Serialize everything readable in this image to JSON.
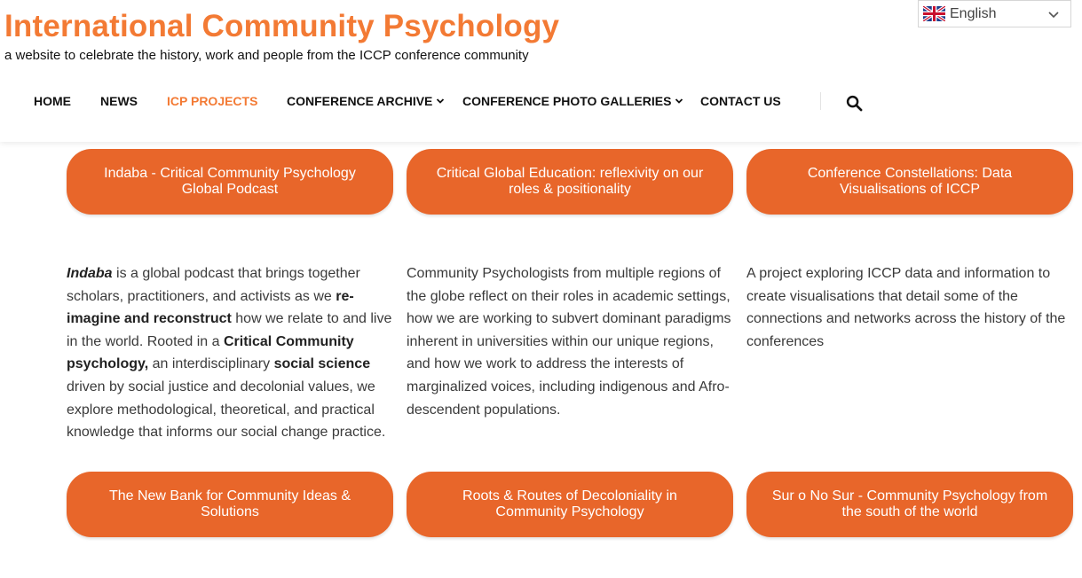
{
  "site": {
    "title": "International Community Psychology",
    "tagline": "a website to celebrate the history, work and people from the ICCP conference community"
  },
  "language": {
    "selected": "English",
    "flag_icon": "uk-flag-icon"
  },
  "nav": {
    "items": [
      {
        "label": "HOME",
        "active": false,
        "has_dropdown": false
      },
      {
        "label": "NEWS",
        "active": false,
        "has_dropdown": false
      },
      {
        "label": "ICP PROJECTS",
        "active": true,
        "has_dropdown": false
      },
      {
        "label": "CONFERENCE ARCHIVE",
        "active": false,
        "has_dropdown": true
      },
      {
        "label": "CONFERENCE PHOTO GALLERIES",
        "active": false,
        "has_dropdown": true
      },
      {
        "label": "CONTACT US",
        "active": false,
        "has_dropdown": false
      }
    ],
    "search_icon": "search-icon"
  },
  "projects": {
    "buttons": [
      "Indaba - Critical Community Psychology Global Podcast",
      "Critical Global Education: reflexivity on our roles & positionality",
      "Conference Constellations: Data Visualisations of ICCP",
      "The New Bank for Community Ideas & Solutions",
      "Roots & Routes of Decoloniality in Community Psychology",
      "Sur o No Sur - Community Psychology from the south of the world"
    ],
    "descriptions": [
      {
        "segments": [
          {
            "text": "Indaba",
            "style": "em"
          },
          {
            "text": " is a global podcast that brings together scholars, practitioners, and activists as we ",
            "style": "normal"
          },
          {
            "text": "re-imagine and reconstruct",
            "style": "strong"
          },
          {
            "text": " how we relate to and live in the world. Rooted in a ",
            "style": "normal"
          },
          {
            "text": "Critical Community psychology,",
            "style": "strong"
          },
          {
            "text": " an interdisciplinary ",
            "style": "normal"
          },
          {
            "text": "social science",
            "style": "strong"
          },
          {
            "text": " driven by social justice and decolonial values, we explore methodological, theoretical, and practical knowledge that informs our social change practice.",
            "style": "normal"
          }
        ]
      },
      {
        "segments": [
          {
            "text": "Community Psychologists from multiple regions of the globe reflect on their roles in academic settings, how we are working to subvert dominant paradigms inherent in universities within our unique regions, and how we work to address the interests of marginalized voices, including indigenous and Afro-descendent populations.",
            "style": "normal"
          }
        ]
      },
      {
        "segments": [
          {
            "text": "A project exploring ICCP data and information to create visualisations that detail some of the connections and networks across the history of the conferences",
            "style": "normal"
          }
        ]
      }
    ]
  },
  "colors": {
    "accent": "#f37a34",
    "button": "#e8662a"
  }
}
